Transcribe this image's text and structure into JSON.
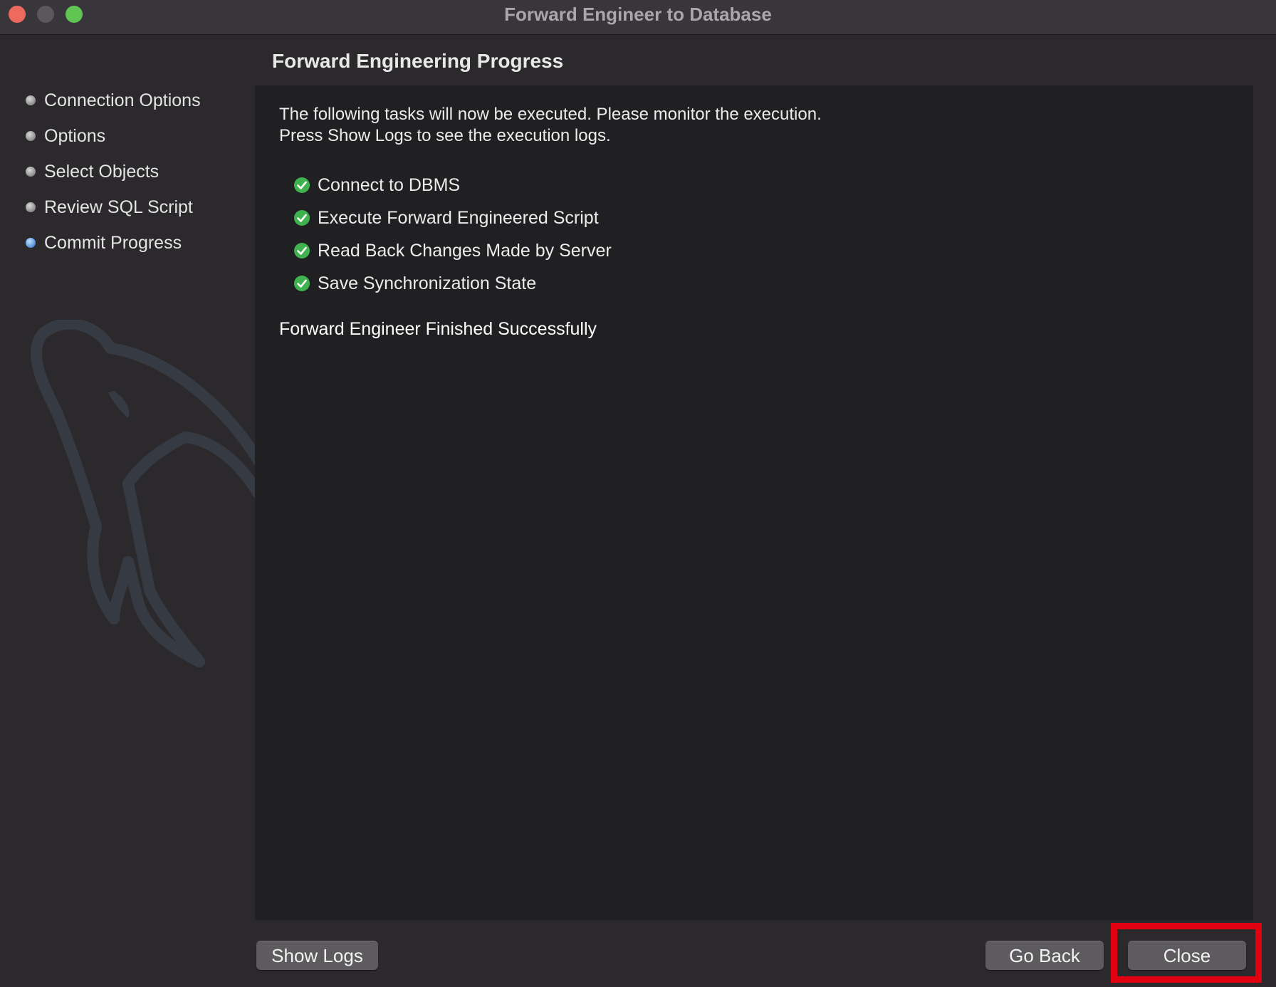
{
  "window": {
    "title": "Forward Engineer to Database"
  },
  "sidebar": {
    "steps": [
      {
        "label": "Connection Options"
      },
      {
        "label": "Options"
      },
      {
        "label": "Select Objects"
      },
      {
        "label": "Review SQL Script"
      },
      {
        "label": "Commit Progress"
      }
    ],
    "current_step": "Commit Progress"
  },
  "main": {
    "title": "Forward Engineering Progress",
    "intro_line1": "The following tasks will now be executed. Please monitor the execution.",
    "intro_line2": "Press Show Logs to see the execution logs.",
    "tasks": [
      {
        "label": "Connect to DBMS",
        "status": "done"
      },
      {
        "label": "Execute Forward Engineered Script",
        "status": "done"
      },
      {
        "label": "Read Back Changes Made by Server",
        "status": "done"
      },
      {
        "label": "Save Synchronization State",
        "status": "done"
      }
    ],
    "result_message": "Forward Engineer Finished Successfully"
  },
  "footer": {
    "show_logs_label": "Show Logs",
    "go_back_label": "Go Back",
    "close_label": "Close"
  },
  "colors": {
    "background": "#2b292c",
    "content_panel": "#202022",
    "check_green": "#3fb34f",
    "current_step_blue": "#4f8fd8",
    "highlight_red": "#e0000f"
  }
}
